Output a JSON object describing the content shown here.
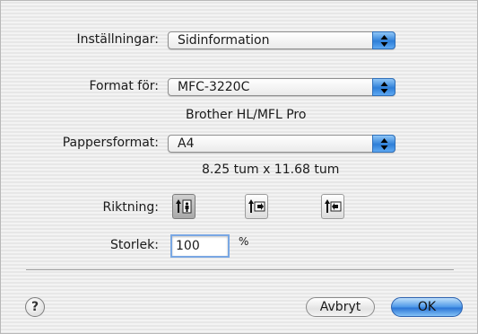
{
  "dialog": {
    "settings": {
      "label": "Inställningar:",
      "value": "Sidinformation"
    },
    "format_for": {
      "label": "Format för:",
      "value": "MFC-3220C",
      "info": "Brother HL/MFL Pro"
    },
    "paper_size": {
      "label": "Pappersformat:",
      "value": "A4",
      "info": "8.25 tum x 11.68 tum"
    },
    "orientation": {
      "label": "Riktning:",
      "options": [
        {
          "name": "portrait",
          "selected": true
        },
        {
          "name": "landscape",
          "selected": false
        },
        {
          "name": "landscape-reversed",
          "selected": false
        }
      ]
    },
    "scale": {
      "label": "Storlek:",
      "value": "100",
      "unit": "%"
    },
    "buttons": {
      "help": "?",
      "cancel": "Avbryt",
      "ok": "OK"
    },
    "colors": {
      "accent": "#3b86e0",
      "background": "#ececec"
    }
  }
}
